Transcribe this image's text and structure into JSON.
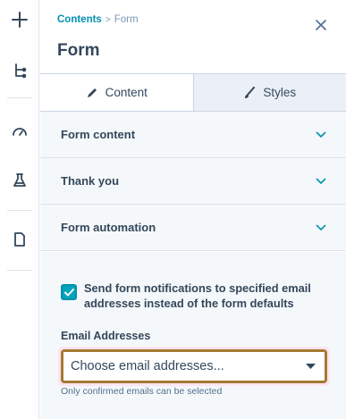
{
  "breadcrumb": {
    "parent": "Contents",
    "separator": ">",
    "current": "Form"
  },
  "title": "Form",
  "tabs": [
    {
      "label": "Content",
      "active": true,
      "icon": "pencil-icon"
    },
    {
      "label": "Styles",
      "active": false,
      "icon": "brush-icon"
    }
  ],
  "sections": [
    {
      "label": "Form content",
      "icon": "chevron-down-icon"
    },
    {
      "label": "Thank you",
      "icon": "chevron-down-icon"
    },
    {
      "label": "Form automation",
      "icon": "chevron-down-icon"
    }
  ],
  "notifications": {
    "checkbox_checked": true,
    "checkbox_label": "Send form notifications to specified email addresses instead of the form defaults"
  },
  "email_field": {
    "label": "Email Addresses",
    "placeholder": "Choose email addresses...",
    "help": "Only confirmed emails can be selected"
  },
  "rail_icons": [
    "plus-icon",
    "tree-icon",
    "gauge-icon",
    "flask-icon",
    "document-icon"
  ],
  "colors": {
    "accent": "#0091ae",
    "text": "#33475b",
    "panel_bg": "#f5f8fa",
    "focus_border": "#a67a32",
    "focus_glow": "#fbe4f0"
  }
}
